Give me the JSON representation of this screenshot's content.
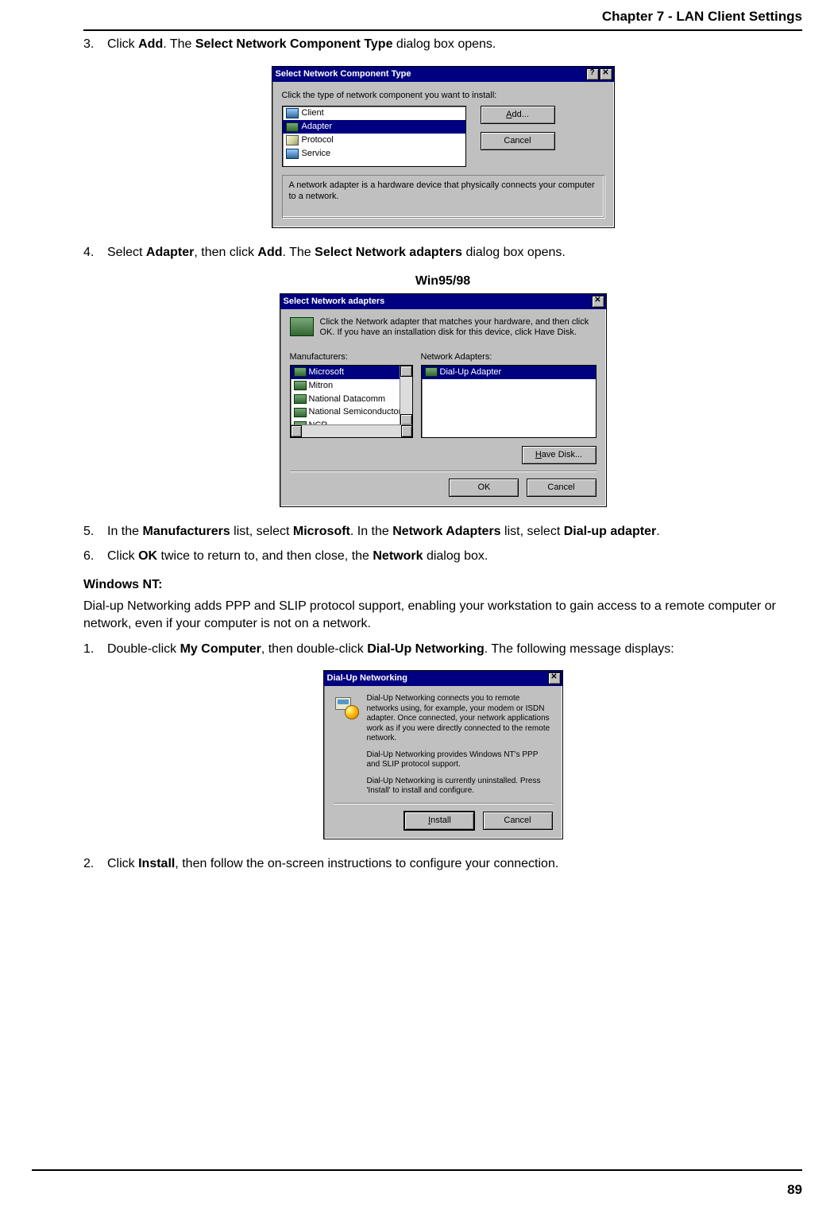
{
  "chapter_title": "Chapter 7 - LAN Client Settings",
  "page_number": "89",
  "step3": {
    "num": "3.",
    "pre": "Click ",
    "b1": "Add",
    "mid": ".  The ",
    "b2": "Select Network Component Type",
    "post": " dialog box opens."
  },
  "dlg1": {
    "title": "Select Network Component Type",
    "help": "?",
    "close": "✕",
    "prompt": "Click the type of network component you want to install:",
    "items": [
      "Client",
      "Adapter",
      "Protocol",
      "Service"
    ],
    "selected_index": 1,
    "add_label": "Add...",
    "add_accel": "A",
    "cancel_label": "Cancel",
    "desc": "A network adapter is a hardware device that physically connects your computer to a network."
  },
  "step4": {
    "num": "4.",
    "pre": "Select ",
    "b1": "Adapter",
    "mid1": ", then click ",
    "b2": "Add",
    "mid2": ". The ",
    "b3": "Select Network adapters",
    "post": " dialog box opens."
  },
  "caption2": "Win95/98",
  "dlg2": {
    "title": "Select Network adapters",
    "close": "✕",
    "prompt": "Click the Network adapter that matches your hardware, and then click OK. If you have an installation disk for this device, click Have Disk.",
    "mfg_label": "Manufacturers:",
    "na_label": "Network Adapters:",
    "mfg_items": [
      "Microsoft",
      "Mitron",
      "National Datacomm",
      "National Semiconductor",
      "NCR"
    ],
    "mfg_sel": 0,
    "na_items": [
      "Dial-Up Adapter"
    ],
    "na_sel": 0,
    "havedisk_label": "Have Disk...",
    "havedisk_accel": "H",
    "ok_label": "OK",
    "cancel_label": "Cancel"
  },
  "step5": {
    "num": "5.",
    "pre": "In the ",
    "b1": "Manufacturers",
    "mid1": " list, select ",
    "b2": "Microsoft",
    "mid2": ". In the ",
    "b3": "Network Adapters",
    "mid3": " list, select ",
    "b4": "Dial-up adapter",
    "post": "."
  },
  "step6": {
    "num": "6.",
    "pre": "Click ",
    "b1": "OK",
    "mid": " twice to return to, and then close, the ",
    "b2": "Network",
    "post": " dialog box."
  },
  "nt_head": "Windows NT:",
  "nt_para": "Dial-up Networking adds PPP and SLIP protocol support, enabling your workstation to gain access to a remote computer or network, even if your computer is not on a network.",
  "nt_step1": {
    "num": "1.",
    "pre": "Double-click ",
    "b1": "My Computer",
    "mid": ", then double-click ",
    "b2": "Dial-Up Networking",
    "post": ". The following message displays:"
  },
  "dlg3": {
    "title": "Dial-Up Networking",
    "close": "✕",
    "p1": "Dial-Up Networking connects you to remote networks using, for example, your modem or ISDN adapter.  Once connected, your network applications work as if you were directly connected to the remote network.",
    "p2": "Dial-Up Networking provides Windows NT's PPP and SLIP protocol support.",
    "p3": "Dial-Up Networking is currently uninstalled. Press 'Install' to install and configure.",
    "install_label": "Install",
    "install_accel": "I",
    "cancel_label": "Cancel"
  },
  "nt_step2": {
    "num": "2.",
    "pre": "Click ",
    "b1": "Install",
    "post": ", then follow the on-screen instructions to configure your connection."
  }
}
